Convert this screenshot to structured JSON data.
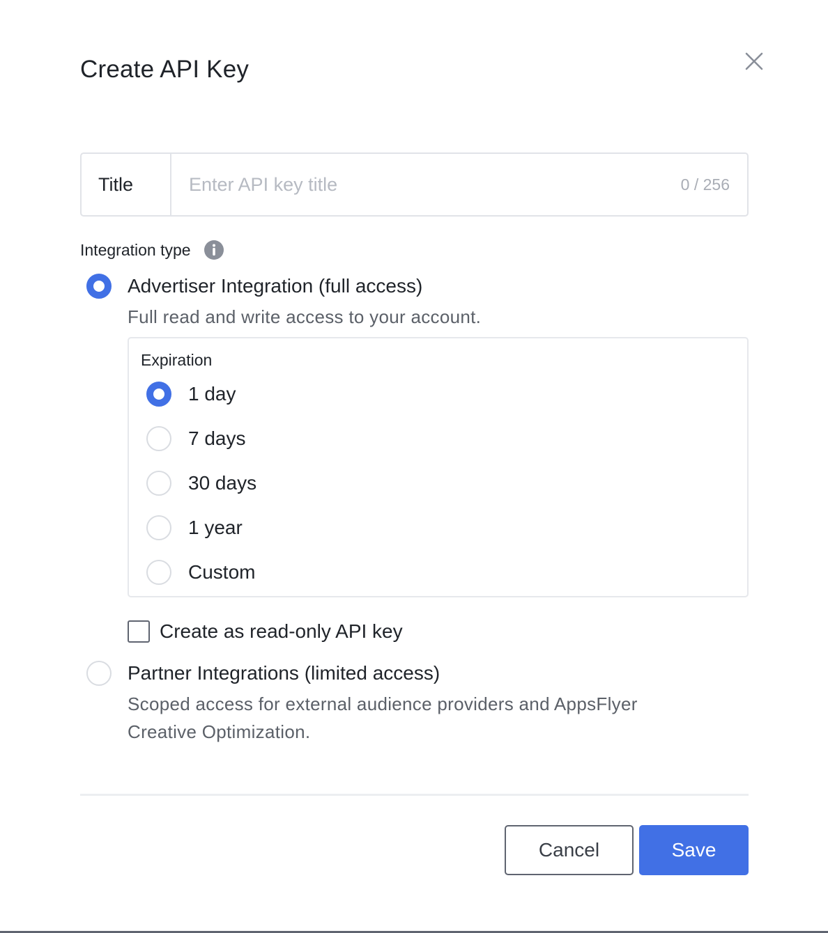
{
  "dialog": {
    "title": "Create API Key"
  },
  "title_field": {
    "label": "Title",
    "placeholder": "Enter API key title",
    "value": "",
    "counter": "0 / 256"
  },
  "integration": {
    "label": "Integration type",
    "options": [
      {
        "label": "Advertiser Integration (full access)",
        "description": "Full read and write access to your account.",
        "selected": true
      },
      {
        "label": "Partner Integrations (limited access)",
        "description_line1": "Scoped access for external audience providers and AppsFlyer",
        "description_line2": "Creative Optimization.",
        "selected": false
      }
    ]
  },
  "expiration": {
    "label": "Expiration",
    "options": [
      {
        "label": "1 day",
        "selected": true
      },
      {
        "label": "7 days",
        "selected": false
      },
      {
        "label": "30 days",
        "selected": false
      },
      {
        "label": "1 year",
        "selected": false
      },
      {
        "label": "Custom",
        "selected": false
      }
    ]
  },
  "readonly": {
    "label": "Create as read-only API key",
    "checked": false
  },
  "actions": {
    "cancel_label": "Cancel",
    "save_label": "Save"
  },
  "colors": {
    "accent": "#4170e5",
    "text": "#1f2329",
    "muted": "#5b6068",
    "border": "#e1e3e8"
  }
}
